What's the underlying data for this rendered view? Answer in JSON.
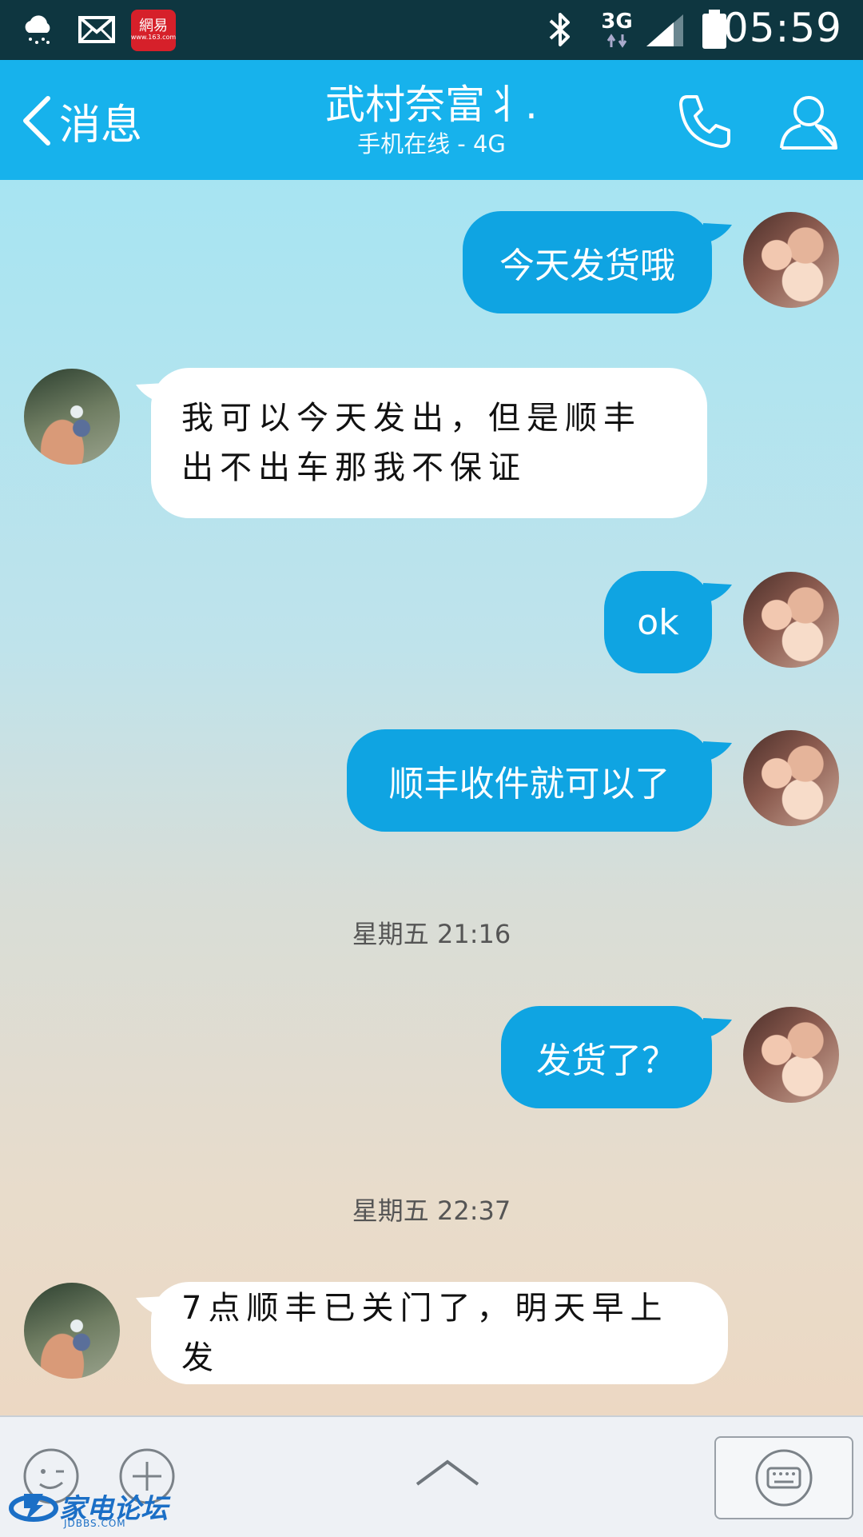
{
  "status_bar": {
    "time": "05:59",
    "network_type": "3G",
    "notification_icons": [
      "weather-cloud-rain-icon",
      "mail-icon",
      "netease-app-icon"
    ],
    "netease_label": "網易",
    "netease_url": "www.163.com"
  },
  "header": {
    "back_label": "消息",
    "contact_name": "武村奈富丬.",
    "contact_status": "手机在线 - 4G"
  },
  "messages": [
    {
      "from": "me",
      "text": "今天发货哦"
    },
    {
      "from": "other",
      "text": "我可以今天发出，但是顺丰出不出车那我不保证"
    },
    {
      "from": "me",
      "text": "ok"
    },
    {
      "from": "me",
      "text": "顺丰收件就可以了"
    },
    {
      "type": "time",
      "text": "星期五 21:16"
    },
    {
      "from": "me",
      "text": "发货了？"
    },
    {
      "type": "time",
      "text": "星期五 22:37"
    },
    {
      "from": "other",
      "text": "7点顺丰已关门了，明天早上发"
    }
  ],
  "watermark": {
    "text": "家电论坛",
    "sub": "JDBBS.COM"
  },
  "colors": {
    "title_bar": "#17b2ec",
    "my_bubble": "#0fa4e2",
    "other_bubble": "#ffffff",
    "status_bar": "#0e3640"
  }
}
